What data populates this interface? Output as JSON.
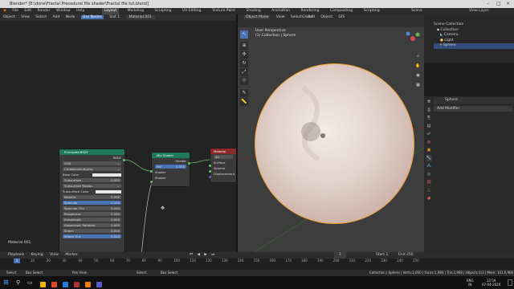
{
  "window": {
    "title": "Blender* [E:\\done\\Fractal Procedural file shader\\Fractal file tut.blend]"
  },
  "menu": [
    "File",
    "Edit",
    "Render",
    "Window",
    "Help"
  ],
  "workspaces": [
    "Layout",
    "Modeling",
    "Sculpting",
    "UV Editing",
    "Texture Paint",
    "Shading",
    "Animation",
    "Rendering",
    "Compositing",
    "Scripting"
  ],
  "active_workspace": "Layout",
  "scene_label": "Scene",
  "viewlayer_label": "View Layer",
  "node_editor": {
    "header": [
      "Object",
      "View",
      "Select",
      "Add",
      "Node",
      "Use Nodes",
      "Slot 1",
      "Material.001"
    ],
    "material_label": "Material.001",
    "principled": {
      "title": "Principled BSDF",
      "output": "BSDF",
      "rows": [
        {
          "label": "GGX",
          "value": ""
        },
        {
          "label": "Christensen-Burley",
          "value": ""
        },
        {
          "label": "Base Color",
          "value": ""
        },
        {
          "label": "Subsurface",
          "value": "0.000"
        },
        {
          "label": "Subsurface Radius",
          "value": ""
        },
        {
          "label": "Subsurface Color",
          "value": ""
        },
        {
          "label": "Metallic",
          "value": "0.000"
        },
        {
          "label": "Specular",
          "value": "0.500"
        },
        {
          "label": "Specular Tint",
          "value": "0.000"
        },
        {
          "label": "Roughness",
          "value": "0.500"
        },
        {
          "label": "Anisotropic",
          "value": "0.000"
        },
        {
          "label": "Anisotropic Rotation",
          "value": "0.000"
        },
        {
          "label": "Sheen",
          "value": "0.000"
        },
        {
          "label": "Sheen Tint",
          "value": "0.500"
        }
      ]
    },
    "mix": {
      "title": "Mix Shader",
      "output": "Shader",
      "fac_label": "Fac",
      "fac_value": "0.500",
      "inputs": [
        "Shader",
        "Shader"
      ]
    },
    "output": {
      "title": "Material Output",
      "target": "All",
      "inputs": [
        "Surface",
        "Volume",
        "Displacement"
      ]
    }
  },
  "viewport": {
    "header": [
      "Object Mode",
      "View",
      "Select",
      "Add",
      "Object",
      "GIS"
    ],
    "orientation": "Global",
    "view_name": "User Perspective",
    "collection_path": "(1) Collection | Sphere"
  },
  "outliner": {
    "title": "Scene Collection",
    "items": [
      "Collection",
      "Camera",
      "Light",
      "Sphere"
    ]
  },
  "properties": {
    "object_name": "Sphere",
    "add_modifier": "Add Modifier"
  },
  "timeline": {
    "menus": [
      "Playback",
      "Keying",
      "View",
      "Marker"
    ],
    "current_frame": "1",
    "start_label": "Start",
    "start": "1",
    "end_label": "End",
    "end": "250",
    "ticks": [
      "0",
      "10",
      "20",
      "30",
      "40",
      "50",
      "60",
      "70",
      "80",
      "90",
      "100",
      "110",
      "120",
      "130",
      "140",
      "150",
      "160",
      "170",
      "180",
      "190",
      "200",
      "210",
      "220",
      "230",
      "240",
      "250"
    ]
  },
  "statusbar": {
    "left": [
      "Select",
      "Box Select",
      "Pan View",
      "Select",
      "Box Select"
    ],
    "info": "Collection | Sphere | Verts:2,000 | Faces:1,984 | Tris:3,968 | Objects:1/3 | Mem: 101.6 MiB | v2.82.7"
  },
  "taskbar": {
    "lang": "ENG",
    "region": "IN",
    "time": "12:59",
    "date": "07-04-2020"
  },
  "colors": {
    "accent": "#4772b3",
    "node_shader": "#1f7a5a",
    "node_output": "#8a2a2a",
    "selection": "#f0a030"
  }
}
